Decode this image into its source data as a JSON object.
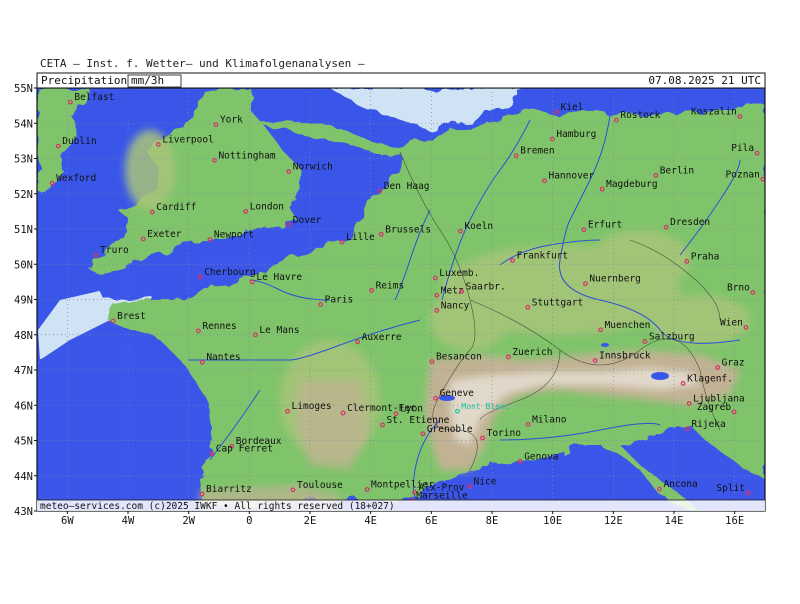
{
  "header": "CETA — Inst. f. Wetter— und Klimafolgenanalysen —",
  "product_label": "Precipitation",
  "unit_label": "mm/3h",
  "valid_time": "07.08.2025 21 UTC",
  "footer": "meteo—services.com  (c)2025 IWKF  •  All rights reserved  (18+027)",
  "lat_labels": [
    "55N",
    "54N",
    "53N",
    "52N",
    "51N",
    "50N",
    "49N",
    "48N",
    "47N",
    "46N",
    "45N",
    "44N",
    "43N"
  ],
  "lon_labels": [
    "6W",
    "4W",
    "2W",
    "0",
    "2E",
    "4E",
    "6E",
    "8E",
    "10E",
    "12E",
    "14E",
    "16E"
  ],
  "colors": {
    "sea": "#3a56e8",
    "lowland": "#7fc46a",
    "highland": "#b7c58a",
    "mountain": "#b8a48a",
    "peak": "#e8e4dc",
    "river": "#2d50d8",
    "city_marker": "#d6336c",
    "highlight_city": "#19c4a0",
    "grid": "#7a8aa0"
  },
  "cities": [
    {
      "name": "Belfast",
      "lon": -5.9,
      "lat": 54.6
    },
    {
      "name": "Dublin",
      "lon": -6.3,
      "lat": 53.35
    },
    {
      "name": "Wexford",
      "lon": -6.5,
      "lat": 52.3
    },
    {
      "name": "York",
      "lon": -1.1,
      "lat": 53.96
    },
    {
      "name": "Liverpool",
      "lon": -3.0,
      "lat": 53.4
    },
    {
      "name": "Nottingham",
      "lon": -1.15,
      "lat": 52.95
    },
    {
      "name": "Norwich",
      "lon": 1.3,
      "lat": 52.63
    },
    {
      "name": "Cardiff",
      "lon": -3.2,
      "lat": 51.48
    },
    {
      "name": "London",
      "lon": -0.12,
      "lat": 51.5
    },
    {
      "name": "Dover",
      "lon": 1.3,
      "lat": 51.12
    },
    {
      "name": "Exeter",
      "lon": -3.5,
      "lat": 50.72
    },
    {
      "name": "Newport",
      "lon": -1.3,
      "lat": 50.7
    },
    {
      "name": "Truro",
      "lon": -5.05,
      "lat": 50.26
    },
    {
      "name": "Kiel",
      "lon": 10.13,
      "lat": 54.32
    },
    {
      "name": "Rostock",
      "lon": 12.1,
      "lat": 54.09
    },
    {
      "name": "Koszalin",
      "lon": 16.17,
      "lat": 54.19
    },
    {
      "name": "Hamburg",
      "lon": 9.99,
      "lat": 53.55
    },
    {
      "name": "Bremen",
      "lon": 8.8,
      "lat": 53.08
    },
    {
      "name": "Pila",
      "lon": 16.74,
      "lat": 53.15
    },
    {
      "name": "Hannover",
      "lon": 9.73,
      "lat": 52.37
    },
    {
      "name": "Berlin",
      "lon": 13.4,
      "lat": 52.52
    },
    {
      "name": "Magdeburg",
      "lon": 11.63,
      "lat": 52.13
    },
    {
      "name": "Poznan",
      "lon": 16.93,
      "lat": 52.41
    },
    {
      "name": "Den Haag",
      "lon": 4.3,
      "lat": 52.08
    },
    {
      "name": "Brussels",
      "lon": 4.35,
      "lat": 50.85
    },
    {
      "name": "Koeln",
      "lon": 6.96,
      "lat": 50.94
    },
    {
      "name": "Erfurt",
      "lon": 11.03,
      "lat": 50.98
    },
    {
      "name": "Dresden",
      "lon": 13.74,
      "lat": 51.05
    },
    {
      "name": "Lille",
      "lon": 3.06,
      "lat": 50.63
    },
    {
      "name": "Frankfurt",
      "lon": 8.68,
      "lat": 50.11
    },
    {
      "name": "Praha",
      "lon": 14.42,
      "lat": 50.08
    },
    {
      "name": "Le Havre",
      "lon": 0.1,
      "lat": 49.5
    },
    {
      "name": "Luxemb.",
      "lon": 6.13,
      "lat": 49.61
    },
    {
      "name": "Cherbourg",
      "lon": -1.62,
      "lat": 49.64
    },
    {
      "name": "Reims",
      "lon": 4.03,
      "lat": 49.26
    },
    {
      "name": "Metz",
      "lon": 6.18,
      "lat": 49.12
    },
    {
      "name": "Saarbr.",
      "lon": 7.0,
      "lat": 49.23
    },
    {
      "name": "Nuernberg",
      "lon": 11.08,
      "lat": 49.45
    },
    {
      "name": "Brno",
      "lon": 16.6,
      "lat": 49.2
    },
    {
      "name": "Paris",
      "lon": 2.35,
      "lat": 48.86
    },
    {
      "name": "Nancy",
      "lon": 6.18,
      "lat": 48.69
    },
    {
      "name": "Stuttgart",
      "lon": 9.18,
      "lat": 48.78
    },
    {
      "name": "Brest",
      "lon": -4.49,
      "lat": 48.39
    },
    {
      "name": "Rennes",
      "lon": -1.68,
      "lat": 48.11
    },
    {
      "name": "Le Mans",
      "lon": 0.2,
      "lat": 48.0
    },
    {
      "name": "Muenchen",
      "lon": 11.58,
      "lat": 48.14
    },
    {
      "name": "Wien",
      "lon": 16.37,
      "lat": 48.21
    },
    {
      "name": "Auxerre",
      "lon": 3.57,
      "lat": 47.8
    },
    {
      "name": "Salzburg",
      "lon": 13.04,
      "lat": 47.81
    },
    {
      "name": "Zuerich",
      "lon": 8.54,
      "lat": 47.37
    },
    {
      "name": "Besancon",
      "lon": 6.02,
      "lat": 47.24
    },
    {
      "name": "Nantes",
      "lon": -1.55,
      "lat": 47.22
    },
    {
      "name": "Innsbruck",
      "lon": 11.4,
      "lat": 47.27
    },
    {
      "name": "Graz",
      "lon": 15.44,
      "lat": 47.07
    },
    {
      "name": "Klagenf.",
      "lon": 14.3,
      "lat": 46.62
    },
    {
      "name": "Ljubljana",
      "lon": 14.5,
      "lat": 46.05
    },
    {
      "name": "Zagreb",
      "lon": 15.98,
      "lat": 45.81
    },
    {
      "name": "Clermont-Fer.",
      "lon": 3.09,
      "lat": 45.78
    },
    {
      "name": "Limoges",
      "lon": 1.26,
      "lat": 45.83
    },
    {
      "name": "Geneve",
      "lon": 6.14,
      "lat": 46.2
    },
    {
      "name": "Mont Blanc",
      "lon": 6.86,
      "lat": 45.83,
      "highlight": true
    },
    {
      "name": "Lyon",
      "lon": 4.84,
      "lat": 45.76
    },
    {
      "name": "St. Etienne",
      "lon": 4.39,
      "lat": 45.44
    },
    {
      "name": "Grenoble",
      "lon": 5.72,
      "lat": 45.19
    },
    {
      "name": "Milano",
      "lon": 9.19,
      "lat": 45.46
    },
    {
      "name": "Rijeka",
      "lon": 14.44,
      "lat": 45.33
    },
    {
      "name": "Torino",
      "lon": 7.69,
      "lat": 45.07
    },
    {
      "name": "Bordeaux",
      "lon": -0.58,
      "lat": 44.84
    },
    {
      "name": "Genova",
      "lon": 8.93,
      "lat": 44.41
    },
    {
      "name": "Cap Ferret",
      "lon": -1.24,
      "lat": 44.63
    },
    {
      "name": "Montpellier",
      "lon": 3.88,
      "lat": 43.61
    },
    {
      "name": "Nice",
      "lon": 7.26,
      "lat": 43.7
    },
    {
      "name": "Alx-Prov",
      "lon": 5.45,
      "lat": 43.53
    },
    {
      "name": "Ancona",
      "lon": 13.52,
      "lat": 43.62
    },
    {
      "name": "Toulouse",
      "lon": 1.44,
      "lat": 43.6
    },
    {
      "name": "Marseille",
      "lon": 5.37,
      "lat": 43.3
    },
    {
      "name": "Biarritz",
      "lon": -1.56,
      "lat": 43.48
    },
    {
      "name": "Split",
      "lon": 16.44,
      "lat": 43.51
    }
  ]
}
